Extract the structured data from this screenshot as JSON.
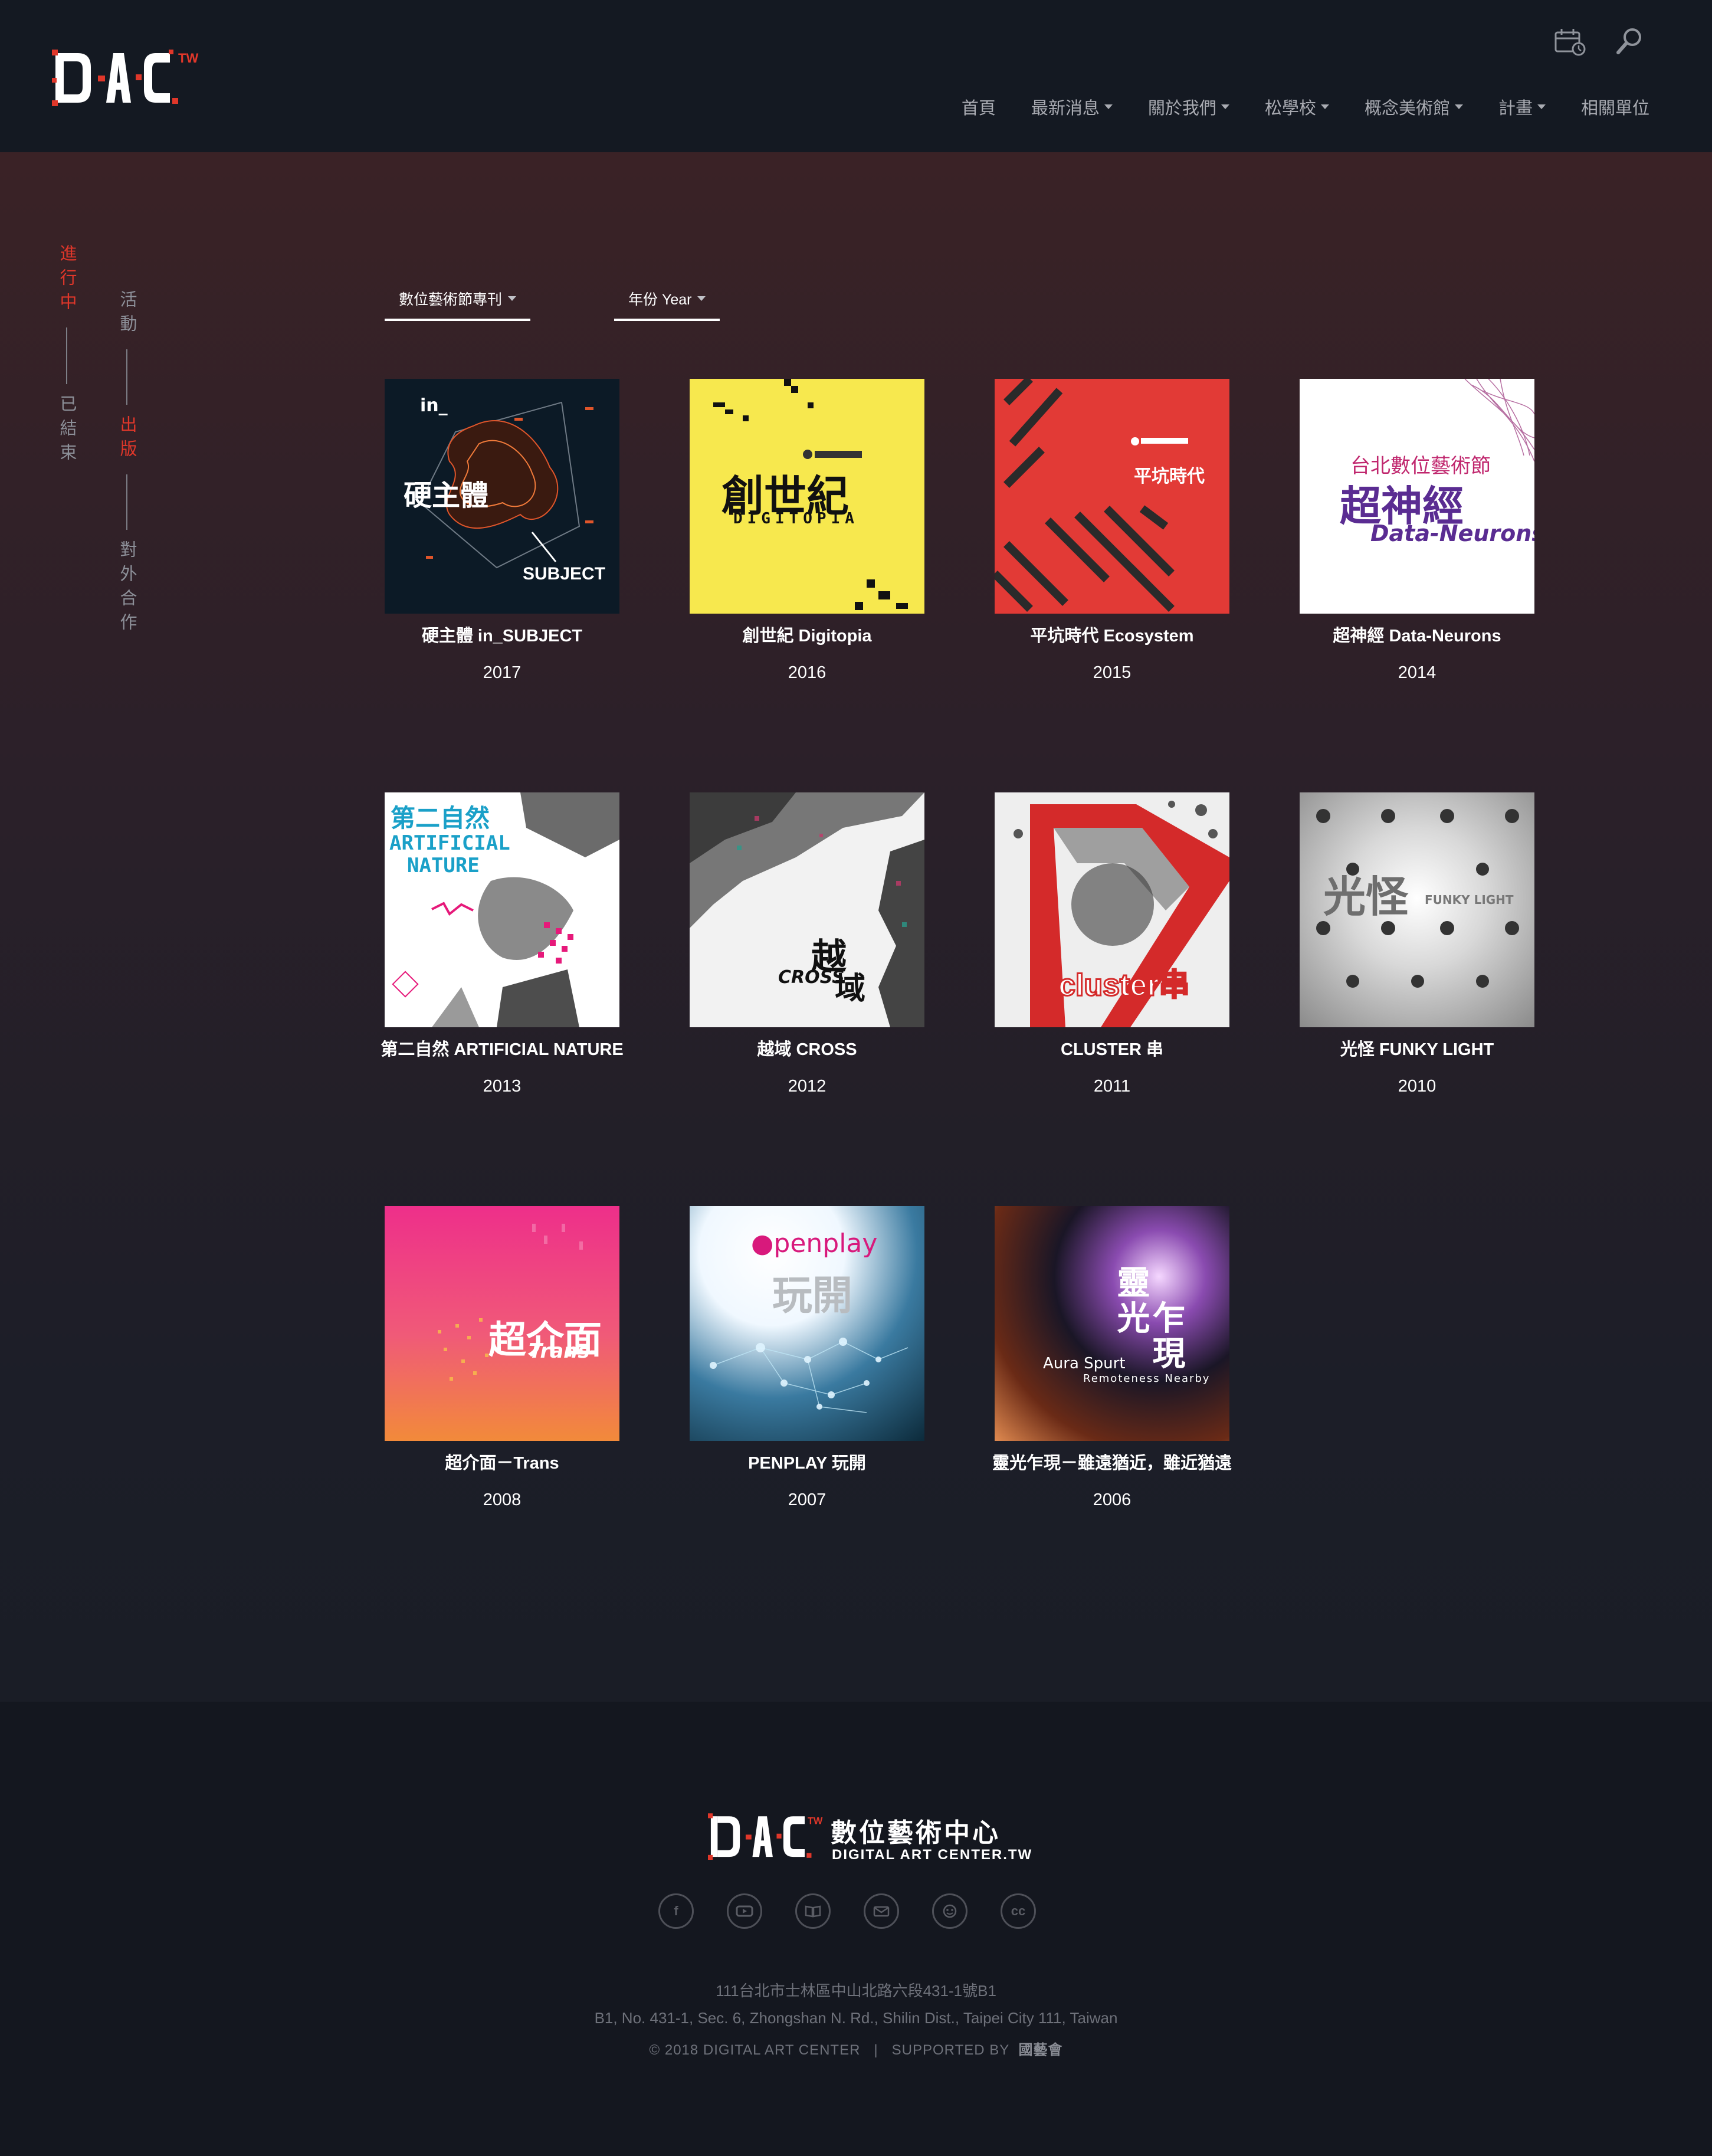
{
  "brand": {
    "logo_text": "DAC",
    "logo_sup": "TW",
    "accent": "#e0372a"
  },
  "header": {
    "utility_icons": [
      "calendar-clock-icon",
      "search-icon"
    ],
    "nav": [
      {
        "label": "首頁",
        "dropdown": false
      },
      {
        "label": "最新消息",
        "dropdown": true
      },
      {
        "label": "關於我們",
        "dropdown": true
      },
      {
        "label": "松學校",
        "dropdown": true
      },
      {
        "label": "概念美術館",
        "dropdown": true
      },
      {
        "label": "計畫",
        "dropdown": true
      },
      {
        "label": "相關單位",
        "dropdown": false
      }
    ]
  },
  "side_nav": {
    "col1": [
      "進行中",
      "已結束"
    ],
    "col2": [
      "活動",
      "出版",
      "對外合作"
    ],
    "active": [
      "進行中",
      "出版"
    ]
  },
  "filters": {
    "category": "數位藝術節專刊",
    "year": "年份 Year"
  },
  "publications": [
    {
      "title": "硬主體 in_SUBJECT",
      "year": "2017"
    },
    {
      "title": "創世紀 Digitopia",
      "year": "2016"
    },
    {
      "title": "平坑時代 Ecosystem",
      "year": "2015"
    },
    {
      "title": "超神經 Data-Neurons",
      "year": "2014"
    },
    {
      "title": "第二自然 ARTIFICIAL NATURE",
      "year": "2013"
    },
    {
      "title": "越域 CROSS",
      "year": "2012"
    },
    {
      "title": "CLUSTER 串",
      "year": "2011"
    },
    {
      "title": "光怪 FUNKY LIGHT",
      "year": "2010"
    },
    {
      "title": "超介面－Trans",
      "year": "2008"
    },
    {
      "title": "PENPLAY 玩開",
      "year": "2007"
    },
    {
      "title": "靈光乍現－雖遠猶近，雖近猶遠",
      "year": "2006"
    }
  ],
  "covers": {
    "c2017": {
      "line1": "in_",
      "line2": "硬主體",
      "line3": "SUBJECT"
    },
    "c2016": {
      "line1": "創世紀",
      "line2": "DIGITOPIA"
    },
    "c2015": {
      "line1": "平坑時代"
    },
    "c2014": {
      "line1": "台北數位藝術節",
      "line2": "超神經",
      "line3": "Data-Neurons"
    },
    "c2013": {
      "line1": "第二自然",
      "line2": "ARTIFICIAL",
      "line3": "NATURE"
    },
    "c2012": {
      "line1": "越",
      "line2": "CROSS",
      "line3": "域"
    },
    "c2011": {
      "line1": "cluster串"
    },
    "c2010": {
      "line1": "光怪",
      "line2": "FUNKY LIGHT"
    },
    "c2008": {
      "line1": "超介面",
      "line2": "Trans-"
    },
    "c2007": {
      "line1": "●penplay",
      "line2": "玩開"
    },
    "c2006": {
      "line1": "靈光",
      "line2": "乍現",
      "line3": "Aura Spurt",
      "line4": "Remoteness Nearby"
    }
  },
  "footer": {
    "logo_cn": "數位藝術中心",
    "logo_en": "DIGITAL ART CENTER.TW",
    "social": [
      "facebook-icon",
      "youtube-icon",
      "book-icon",
      "mail-icon",
      "face-icon",
      "cc-icon"
    ],
    "address_cn": "111台北市士林區中山北路六段431-1號B1",
    "address_en": "B1, No. 431-1, Sec. 6, Zhongshan N. Rd., Shilin Dist., Taipei City 111, Taiwan",
    "copyright": "© 2018 DIGITAL ART CENTER   |   SUPPORTED BY",
    "supporter": "國藝會"
  }
}
